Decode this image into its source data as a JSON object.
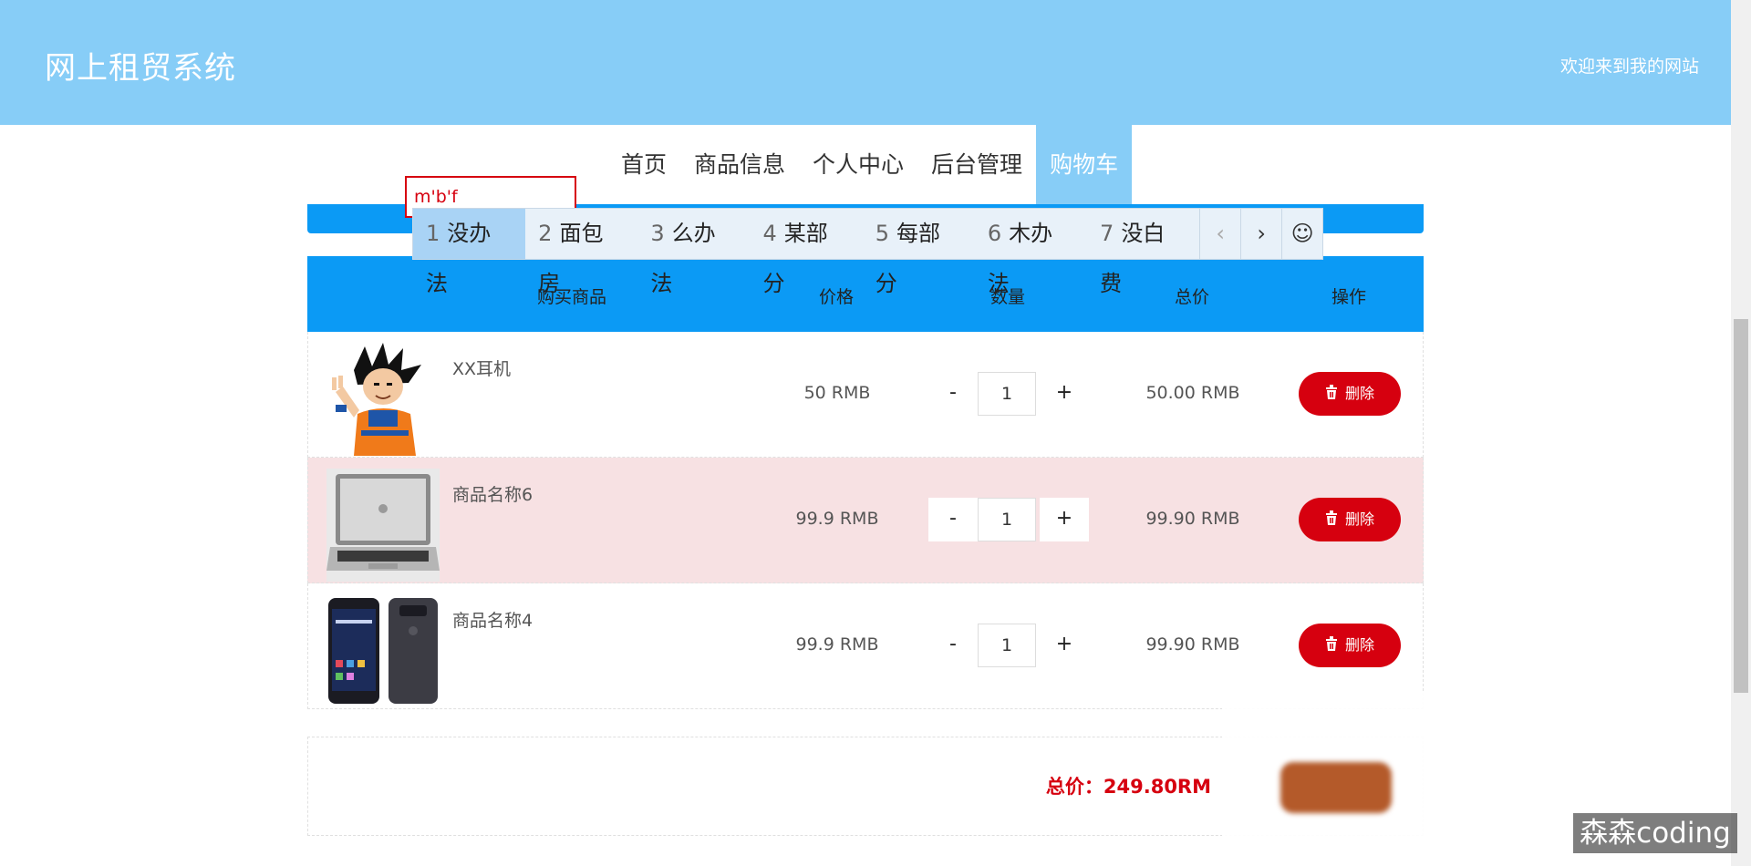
{
  "header": {
    "site_title": "网上租贸系统",
    "welcome": "欢迎来到我的网站"
  },
  "nav": {
    "items": [
      {
        "label": "首页",
        "active": false
      },
      {
        "label": "商品信息",
        "active": false
      },
      {
        "label": "个人中心",
        "active": false
      },
      {
        "label": "后台管理",
        "active": false
      },
      {
        "label": "购物车",
        "active": true
      }
    ]
  },
  "ime": {
    "composition": "m'b'f",
    "candidates": [
      {
        "num": "1",
        "text": "没办法"
      },
      {
        "num": "2",
        "text": "面包房"
      },
      {
        "num": "3",
        "text": "么办法"
      },
      {
        "num": "4",
        "text": "某部分"
      },
      {
        "num": "5",
        "text": "每部分"
      },
      {
        "num": "6",
        "text": "木办法"
      },
      {
        "num": "7",
        "text": "没白费"
      }
    ],
    "prev": "‹",
    "next": "›",
    "emoji": "☺"
  },
  "table": {
    "headers": [
      "购买商品",
      "价格",
      "数量",
      "总价",
      "操作"
    ],
    "rows": [
      {
        "name": "XX耳机",
        "price": "50 RMB",
        "qty": "1",
        "total": "50.00 RMB",
        "delete": "删除",
        "image": "cartoon-character"
      },
      {
        "name": "商品名称6",
        "price": "99.9 RMB",
        "qty": "1",
        "total": "99.90 RMB",
        "delete": "删除",
        "image": "laptop"
      },
      {
        "name": "商品名称4",
        "price": "99.9 RMB",
        "qty": "1",
        "total": "99.90 RMB",
        "delete": "删除",
        "image": "smartphone"
      }
    ],
    "minus": "-",
    "plus": "+"
  },
  "summary": {
    "total_text": "总价：249.80RM"
  },
  "watermark": "森森coding",
  "colors": {
    "header_bg": "#87cdf7",
    "table_header_bg": "#0b9af5",
    "delete_button": "#d6000f",
    "highlight_row": "#f7e1e3"
  }
}
